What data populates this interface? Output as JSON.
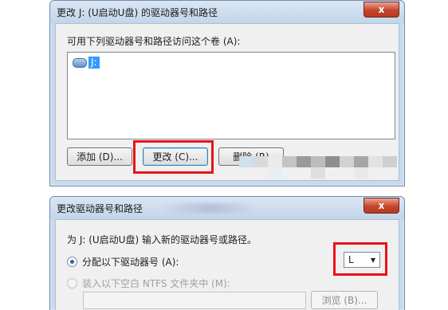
{
  "dialog1": {
    "title": "更改 J: (U启动U盘) 的驱动器号和路径",
    "close_label": "x",
    "list_label": "可用下列驱动器号和路径访问这个卷 (A):",
    "volume_item": "J:",
    "buttons": {
      "add": "添加 (D)...",
      "change": "更改 (C)...",
      "remove": "删除 (R)"
    }
  },
  "dialog2": {
    "title": "更改驱动器号和路径",
    "close_label": "x",
    "prompt": "为 J: (U启动U盘) 输入新的驱动器号或路径。",
    "assign_label": "分配以下驱动器号 (A):",
    "mount_label": "装入以下空白 NTFS 文件夹中 (M):",
    "drive_letter": "L",
    "dropdown_arrow": "▾",
    "browse_label": "浏览 (B)..."
  },
  "colors": {
    "highlight": "#e8121b",
    "selection": "#3399ff",
    "window_frame": "#c9daed",
    "close_button": "#c7452a"
  }
}
